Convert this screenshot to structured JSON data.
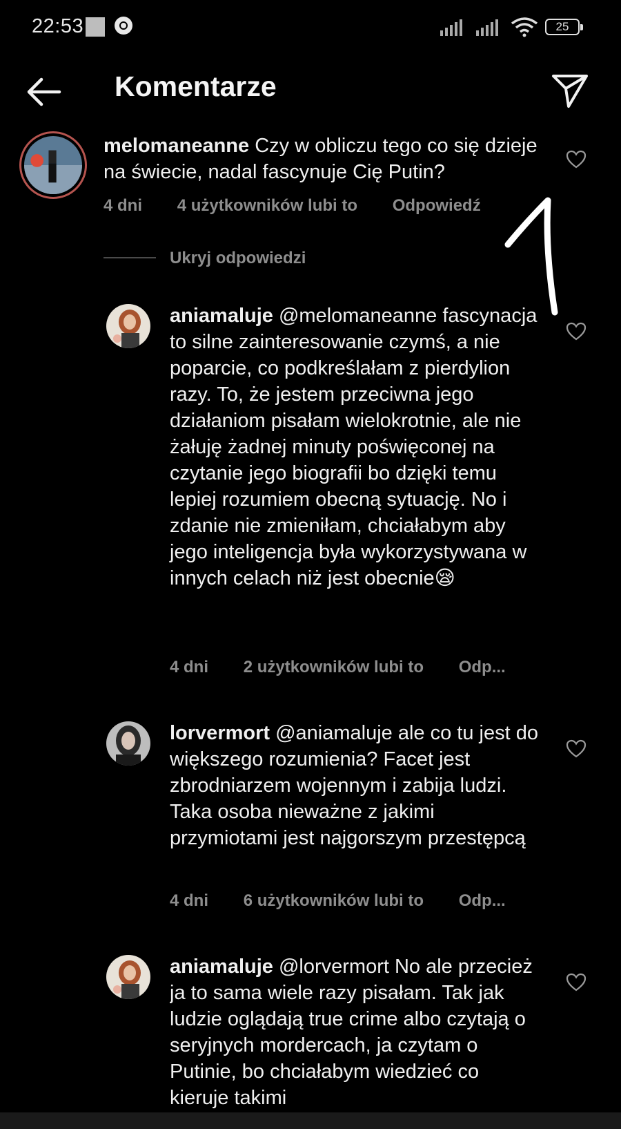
{
  "status": {
    "time": "22:53",
    "battery": "25",
    "icons": [
      "gallery-icon",
      "sync-icon",
      "signal-icon",
      "signal-icon",
      "wifi-icon",
      "battery-icon"
    ]
  },
  "header": {
    "title": "Komentarze",
    "back_icon": "arrow-left-icon",
    "send_icon": "send-icon"
  },
  "main_comment": {
    "username": "melomaneanne",
    "text": " Czy w obliczu tego co się dzieje na świecie, nadal fascynuje Cię Putin?",
    "time": "4 dni",
    "likes": "4 użytkowników lubi to",
    "reply": "Odpowiedź"
  },
  "hide_replies": "Ukryj odpowiedzi",
  "replies": [
    {
      "username": "aniamaluje",
      "text": " @melomaneanne fascynacja to silne zainteresowanie czymś, a nie poparcie, co podkreślałam z pierdylion razy. To, że jestem przeciwna jego działaniom pisałam wielokrotnie, ale nie żałuję żadnej minuty poświęconej na czytanie jego biografii bo dzięki temu lepiej rozumiem obecną sytuację. No i zdanie nie zmieniłam, chciałabym aby jego inteligencja była wykorzystywana w innych celach niż jest obecnie😪",
      "time": "4 dni",
      "likes": "2 użytkowników lubi to",
      "reply": "Odp..."
    },
    {
      "username": "lorvermort",
      "text": " @aniamaluje ale co tu jest do większego rozumienia? Facet jest zbrodniarzem wojennym i zabija ludzi. Taka osoba nieważne z jakimi przymiotami jest najgorszym przestępcą",
      "time": "4 dni",
      "likes": "6 użytkowników lubi to",
      "reply": "Odp..."
    },
    {
      "username": "aniamaluje",
      "text": " @lorvermort No ale przecież ja to sama wiele razy pisałam. Tak jak ludzie oglądają true crime albo czytają o seryjnych mordercach, ja czytam o Putinie, bo chciałabym wiedzieć co kieruje takimi"
    }
  ]
}
